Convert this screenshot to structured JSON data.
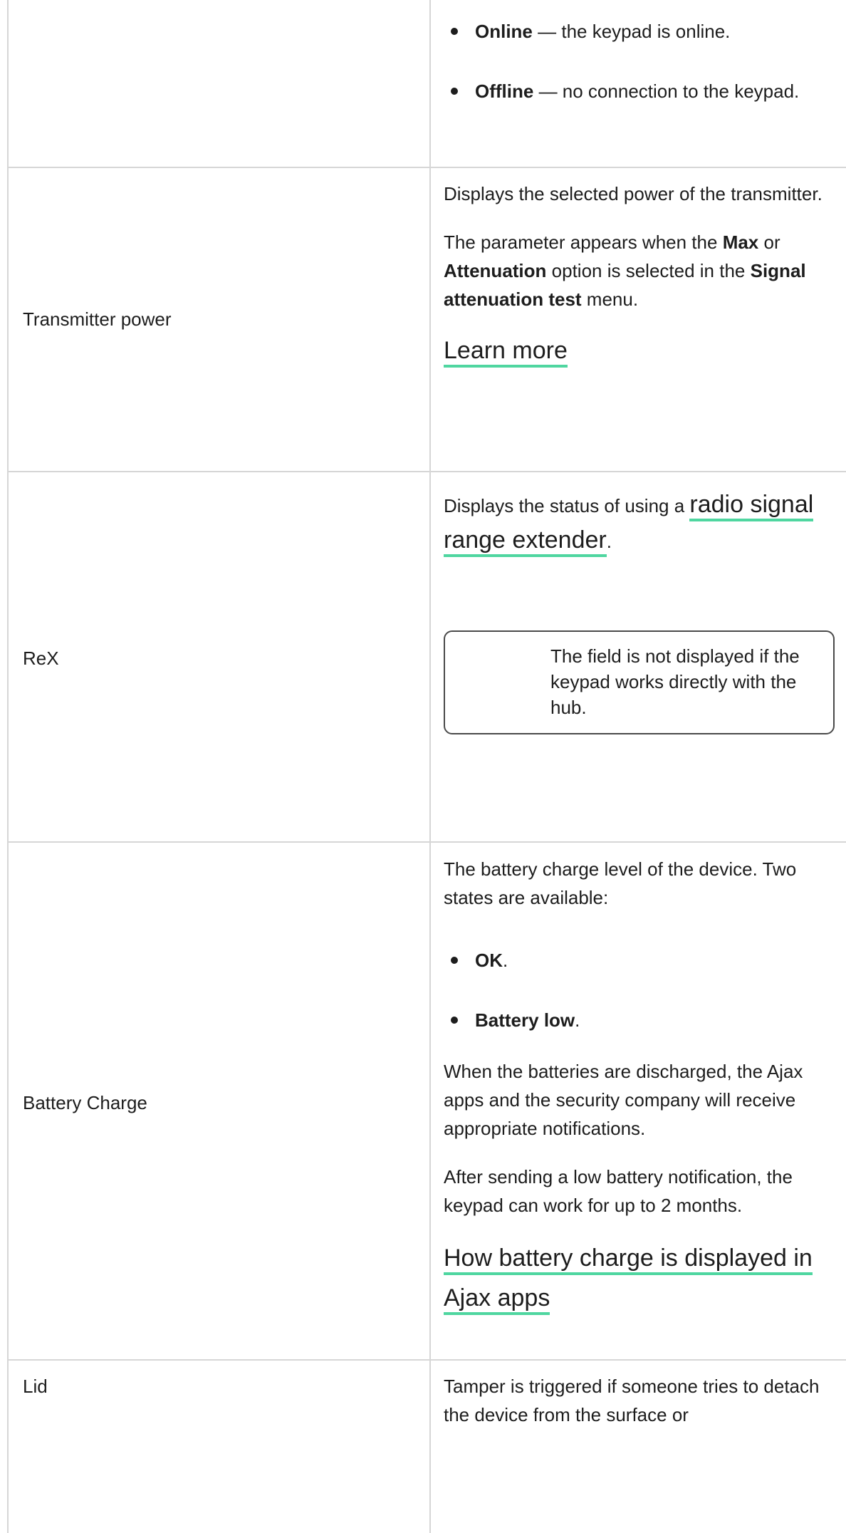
{
  "rows": {
    "connection": {
      "bullets": [
        {
          "term": "Online",
          "text": " — the keypad is online."
        },
        {
          "term": "Offline",
          "text": " — no connection to the keypad."
        }
      ]
    },
    "transmitter_power": {
      "label": "Transmitter power",
      "p1": "Displays the selected power of the transmitter.",
      "p2_a": "The parameter appears when the ",
      "p2_max": "Max",
      "p2_b": " or ",
      "p2_att": "Attenuation",
      "p2_c": " option is selected in the ",
      "p2_menu": "Signal attenuation test",
      "p2_d": " menu.",
      "link": "Learn more"
    },
    "rex": {
      "label": "ReX",
      "p1_a": "Displays the status of using a ",
      "p1_link": "radio signal range extender",
      "p1_b": ".",
      "note": "The field is not displayed if the keypad works directly with the hub."
    },
    "battery": {
      "label": "Battery Charge",
      "p1": "The battery charge level of the device. Two states are available:",
      "bullets": [
        {
          "term": "OK",
          "text": "."
        },
        {
          "term": "Battery low",
          "text": "."
        }
      ],
      "p2": "When the batteries are discharged, the Ajax apps and the security company will receive appropriate notifications.",
      "p3": "After sending a low battery notification, the keypad can work for up to 2 months.",
      "link": "How battery charge is displayed in Ajax apps"
    },
    "lid": {
      "label": "Lid",
      "p1": "Tamper is triggered if someone tries to detach the device from the surface or"
    }
  },
  "colors": {
    "link_underline": "#4fd6a0",
    "warning_icon": "#f26d6d",
    "border": "#d6d6d6"
  }
}
